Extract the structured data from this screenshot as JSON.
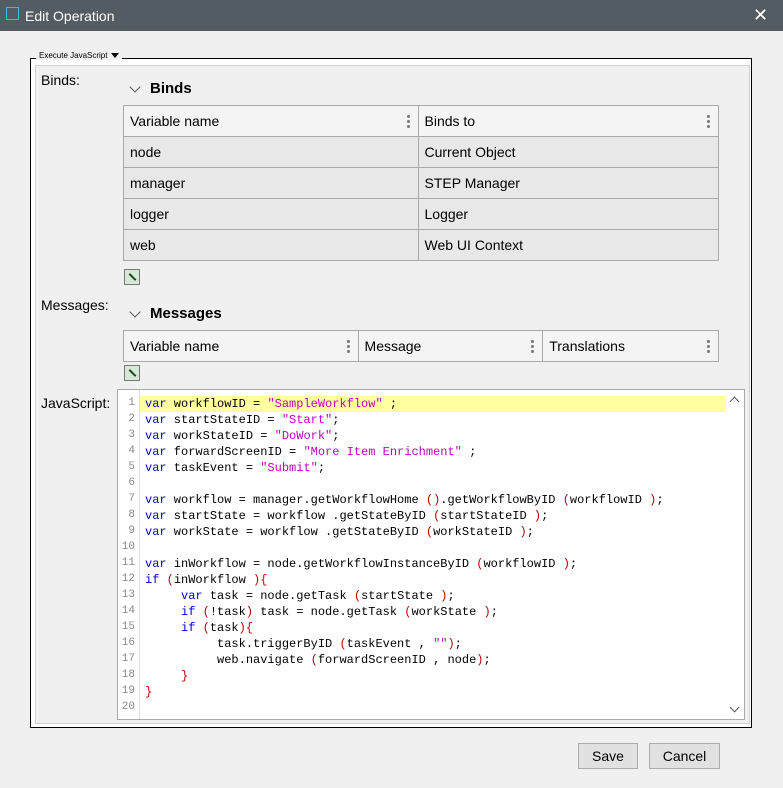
{
  "window": {
    "title": "Edit Operation",
    "close_glyph": "✕"
  },
  "group": {
    "legend": "Execute JavaScript"
  },
  "labels": {
    "binds": "Binds:",
    "messages": "Messages:",
    "javascript": "JavaScript:"
  },
  "binds": {
    "heading": "Binds",
    "columns": [
      "Variable name",
      "Binds to"
    ],
    "rows": [
      [
        "node",
        "Current Object"
      ],
      [
        "manager",
        "STEP Manager"
      ],
      [
        "logger",
        "Logger"
      ],
      [
        "web",
        "Web UI Context"
      ]
    ]
  },
  "messages": {
    "heading": "Messages",
    "columns": [
      "Variable name",
      "Message",
      "Translations"
    ]
  },
  "code": {
    "lines": [
      "var workflowID = \"SampleWorkflow\" ;",
      "var startStateID = \"Start\";",
      "var workStateID = \"DoWork\";",
      "var forwardScreenID = \"More Item Enrichment\" ;",
      "var taskEvent = \"Submit\";",
      "",
      "var workflow = manager.getWorkflowHome ().getWorkflowByID (workflowID );",
      "var startState = workflow .getStateByID (startStateID );",
      "var workState = workflow .getStateByID (workStateID );",
      "",
      "var inWorkflow = node.getWorkflowInstanceByID (workflowID );",
      "if (inWorkflow ){",
      "     var task = node.getTask (startState );",
      "     if (!task) task = node.getTask (workState );",
      "     if (task){",
      "          task.triggerByID (taskEvent , \"\");",
      "          web.navigate (forwardScreenID , node);",
      "     }",
      "}",
      ""
    ]
  },
  "buttons": {
    "save": "Save",
    "cancel": "Cancel"
  },
  "icons": {
    "app": "window-icon",
    "add_bind": "add-row-icon",
    "add_message": "add-row-icon"
  },
  "colors": {
    "titlebar": "#535b63",
    "keyword": "#0000cc",
    "string": "#c000c0",
    "bracket": "#c00000",
    "highlight": "#ffffa0"
  }
}
